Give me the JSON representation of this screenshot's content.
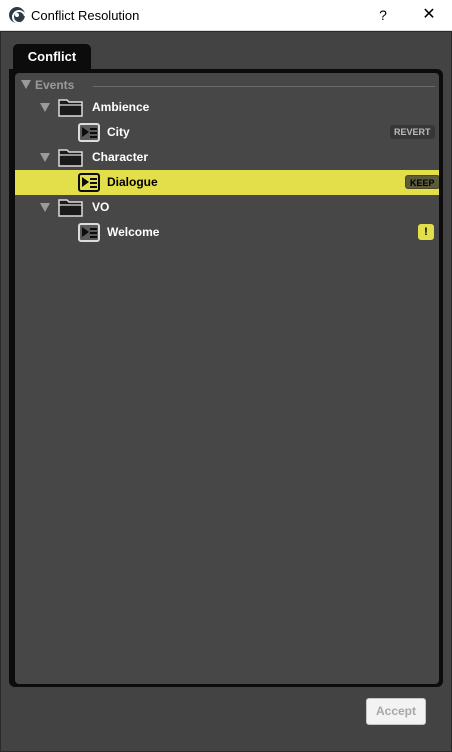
{
  "window": {
    "title": "Conflict Resolution",
    "help_label": "?",
    "close_label": "✕"
  },
  "tabs": [
    {
      "label": "Conflict"
    }
  ],
  "tree": {
    "root_label": "Events",
    "folders": [
      {
        "label": "Ambience",
        "events": [
          {
            "label": "City",
            "status": "REVERT"
          }
        ]
      },
      {
        "label": "Character",
        "events": [
          {
            "label": "Dialogue",
            "status": "KEEP",
            "selected": true
          }
        ]
      },
      {
        "label": "VO",
        "events": [
          {
            "label": "Welcome",
            "status": "!"
          }
        ]
      }
    ]
  },
  "footer": {
    "accept_label": "Accept"
  },
  "colors": {
    "highlight": "#e2df4a",
    "panel_bg": "#474747",
    "frame_bg": "#434343"
  },
  "icons": {
    "app": "fmod-logo-icon",
    "folder": "folder-icon",
    "event": "event-icon",
    "expand": "expand-arrow-icon",
    "warning": "warning-icon"
  }
}
